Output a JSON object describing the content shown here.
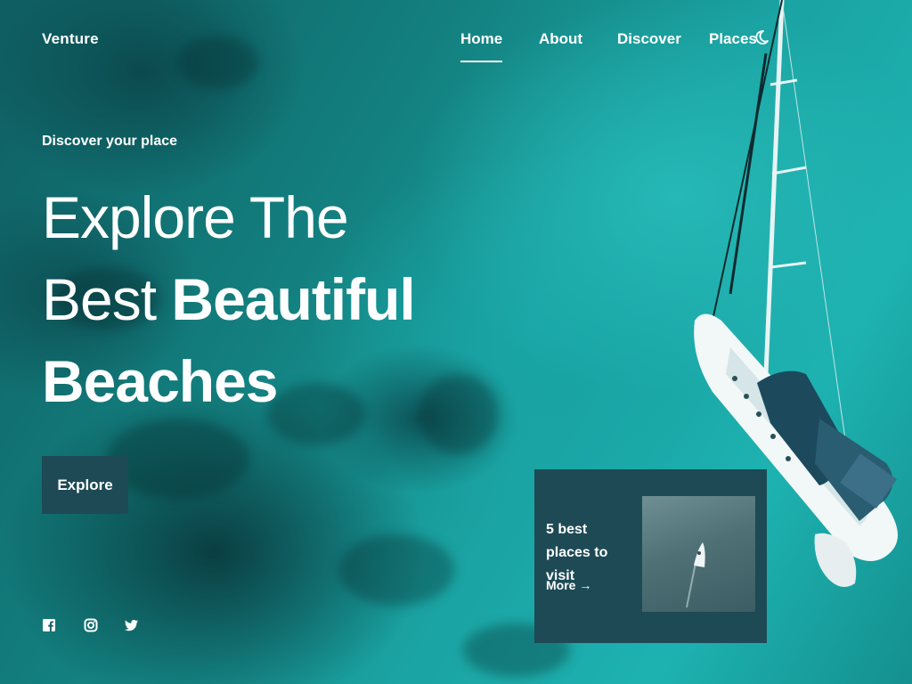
{
  "header": {
    "logo": "Venture",
    "nav": [
      {
        "label": "Home",
        "active": true
      },
      {
        "label": "About",
        "active": false
      },
      {
        "label": "Discover",
        "active": false
      },
      {
        "label": "Places",
        "active": false
      }
    ],
    "theme_toggle_icon": "moon-icon"
  },
  "hero": {
    "subtitle": "Discover your place",
    "title_line1": "Explore The",
    "title_line2_regular": "Best",
    "title_line2_bold": "Beautiful",
    "title_line3_bold": "Beaches",
    "button_label": "Explore"
  },
  "socials": [
    {
      "icon": "facebook-icon"
    },
    {
      "icon": "instagram-icon"
    },
    {
      "icon": "twitter-icon"
    }
  ],
  "card": {
    "title": "5 best places to visit",
    "more_label": "More"
  },
  "colors": {
    "card_bg": "#1d4a55",
    "text": "#ffffff"
  }
}
